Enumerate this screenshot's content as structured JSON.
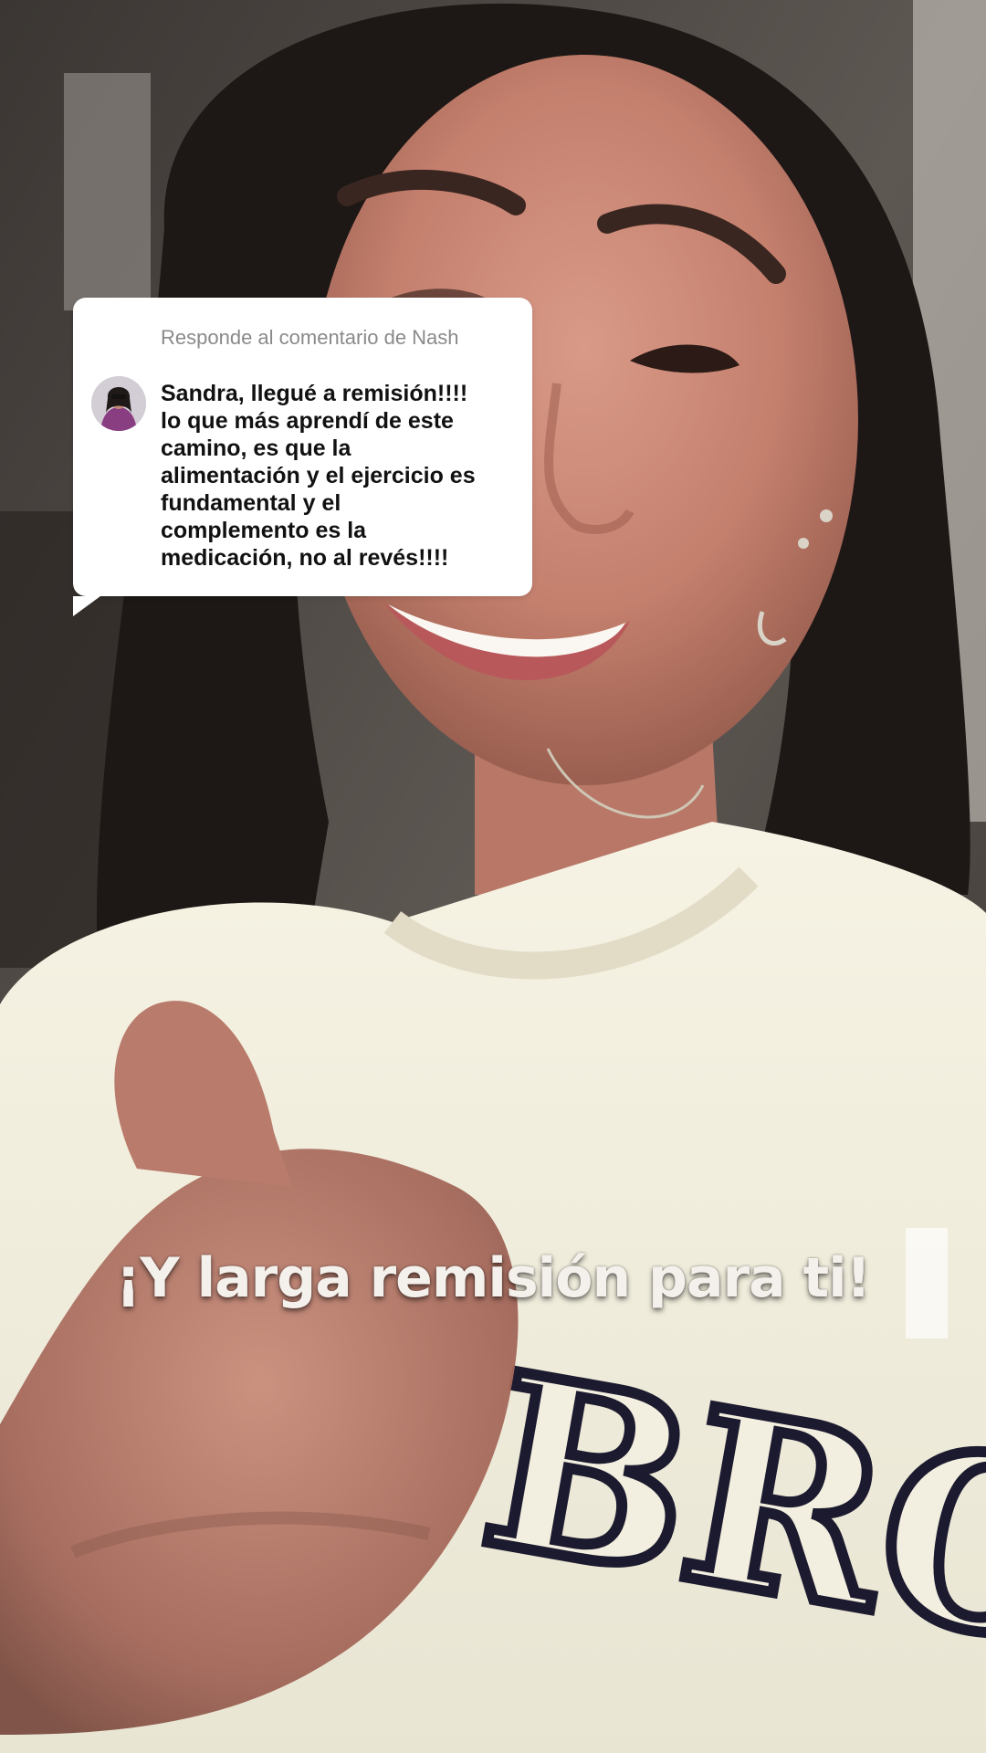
{
  "reply_card": {
    "header": "Responde al comentario de Nash",
    "comment": "Sandra, llegué a remisión!!!!\nlo que más aprendí de este\ncamino, es que la\nalimentación y el ejercicio es\nfundamental y el\ncomplemento es la\nmedicación, no al revés!!!!"
  },
  "caption": {
    "text": "¡Y larga remisión para ti!"
  },
  "shirt_print": {
    "text": "BRO"
  },
  "colors": {
    "card_bg": "#ffffff",
    "header_text": "#8a8a8a",
    "comment_text": "#111111",
    "caption_text": "#f4f0ec",
    "shirt": "#f3efe0",
    "shirt_print": "#1c1a2e"
  },
  "icons": {
    "commenter_avatar": "avatar"
  }
}
